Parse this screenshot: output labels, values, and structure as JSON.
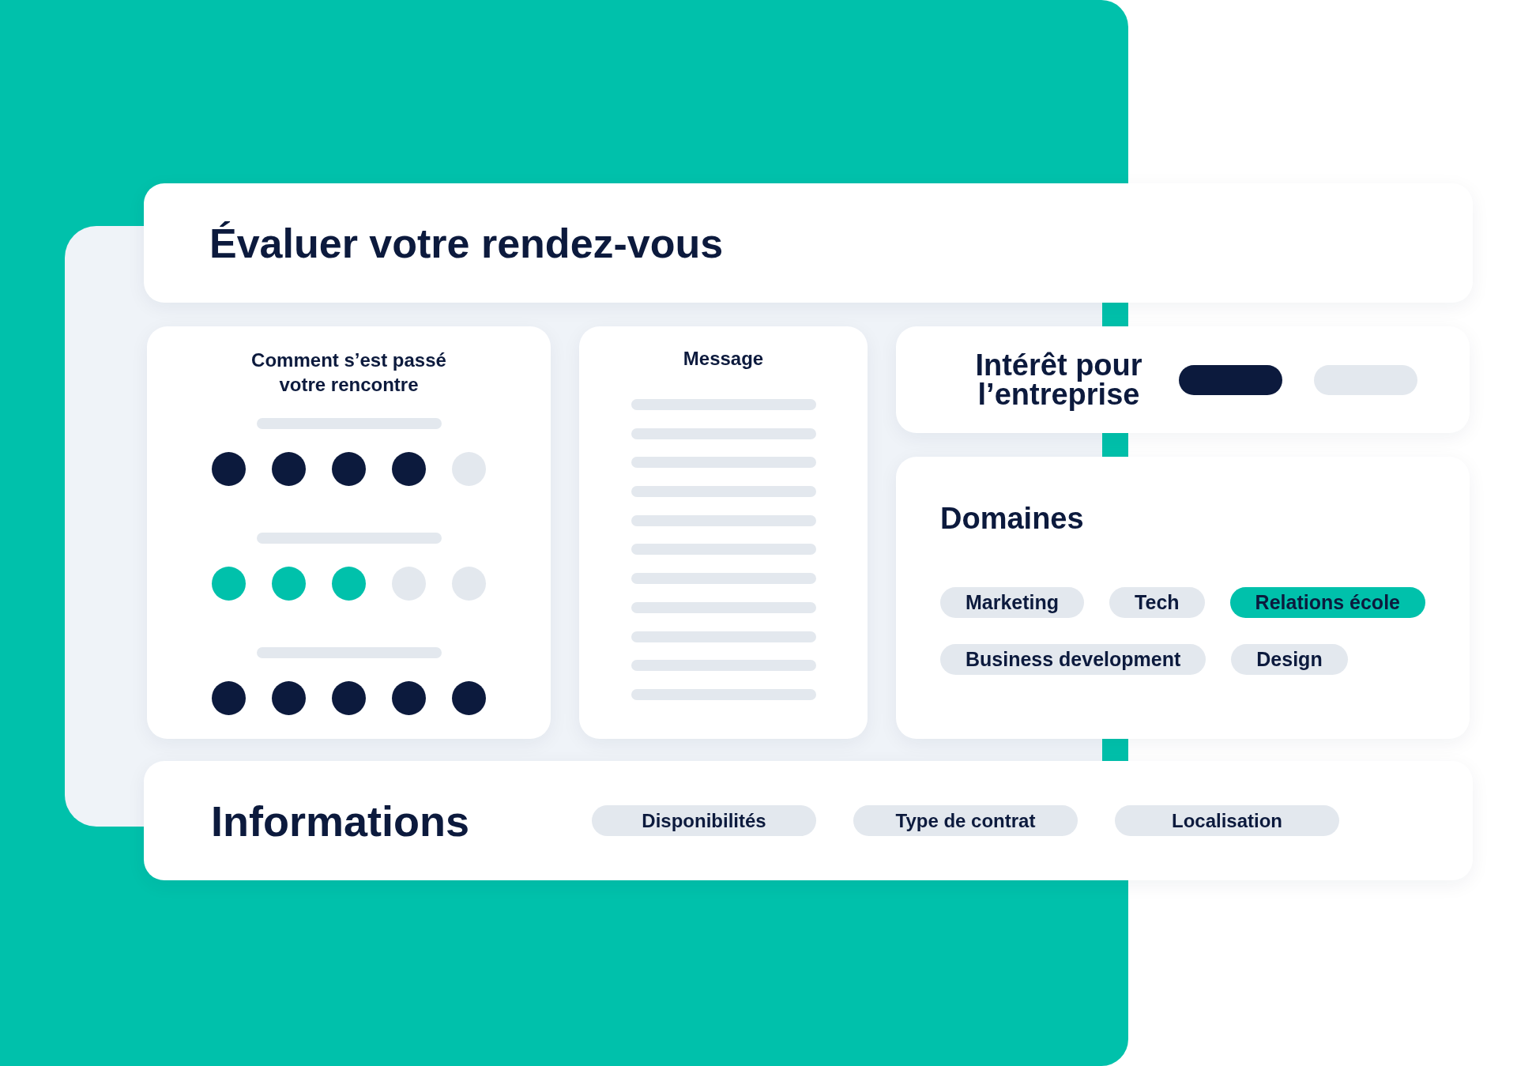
{
  "title": "Évaluer votre rendez-vous",
  "rating_card": {
    "title": "Comment s’est passé votre rencontre",
    "ratings": [
      {
        "stars": 4,
        "color": "#0c1a3d"
      },
      {
        "stars": 3,
        "color": "#00c1ab"
      },
      {
        "stars": 5,
        "color": "#0c1a3d"
      }
    ]
  },
  "message_card": {
    "title": "Message"
  },
  "interest_card": {
    "title": "Intérêt pour l’entreprise",
    "options": [
      {
        "selected": true
      },
      {
        "selected": false
      }
    ]
  },
  "domains_card": {
    "title": "Domaines",
    "tags": [
      {
        "label": "Marketing",
        "selected": false
      },
      {
        "label": "Tech",
        "selected": false
      },
      {
        "label": "Relations école",
        "selected": true
      },
      {
        "label": "Business development",
        "selected": false
      },
      {
        "label": "Design",
        "selected": false
      }
    ]
  },
  "info_card": {
    "title": "Informations",
    "tags": [
      "Disponibilités",
      "Type de contrat",
      "Localisation"
    ]
  }
}
